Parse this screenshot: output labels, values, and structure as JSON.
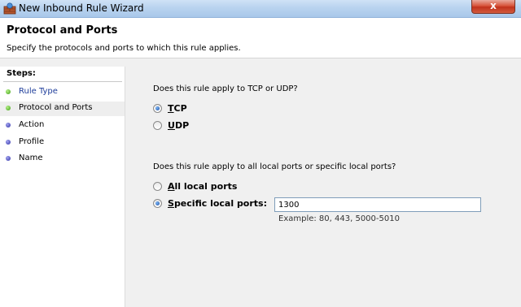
{
  "window": {
    "title": "New Inbound Rule Wizard",
    "close_glyph": "x"
  },
  "header": {
    "title": "Protocol and Ports",
    "subtitle": "Specify the protocols and ports to which this rule applies."
  },
  "steps": {
    "title": "Steps:",
    "items": [
      {
        "label": "Rule Type",
        "state": "done"
      },
      {
        "label": "Protocol and Ports",
        "state": "current"
      },
      {
        "label": "Action",
        "state": "pending"
      },
      {
        "label": "Profile",
        "state": "pending"
      },
      {
        "label": "Name",
        "state": "pending"
      }
    ]
  },
  "protocol": {
    "question": "Does this rule apply to TCP or UDP?",
    "options": [
      {
        "label": "TCP",
        "mnemonic": "T",
        "checked": true
      },
      {
        "label": "UDP",
        "mnemonic": "U",
        "checked": false
      }
    ]
  },
  "ports": {
    "question": "Does this rule apply to all local ports or specific local ports?",
    "options": [
      {
        "label": "All local ports",
        "mnemonic": "A",
        "checked": false
      },
      {
        "label": "Specific local ports:",
        "mnemonic": "S",
        "checked": true
      }
    ],
    "value": "1300",
    "example": "Example: 80, 443, 5000-5010"
  },
  "colors": {
    "accent_link": "#1e3d9a",
    "step_done": "#3a9b10",
    "step_pending": "#2d2fa6",
    "close": "#c1321b"
  }
}
